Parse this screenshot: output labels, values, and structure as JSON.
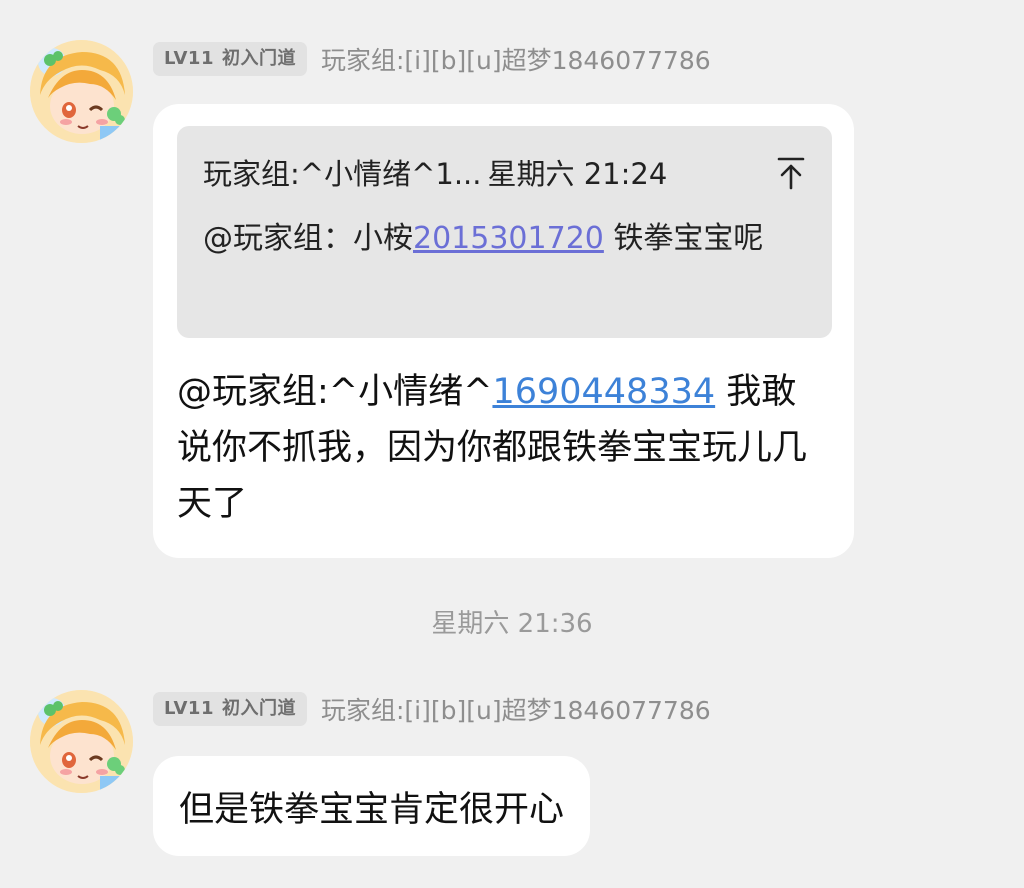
{
  "messages": [
    {
      "level": "LV11",
      "rank": "初入门道",
      "sender": "玩家组:[i][b][u]超梦1846077786",
      "quote": {
        "sender": "玩家组:^小情绪^1...",
        "time": "星期六 21:24",
        "mention_prefix": "@玩家组：小桉",
        "mention_number": "2015301720",
        "text": " 铁拳宝宝呢"
      },
      "mention_prefix": "@玩家组:^小情绪^",
      "mention_number": "1690448334",
      "text": " 我敢说你不抓我，因为你都跟铁拳宝宝玩儿几天了"
    },
    {
      "level": "LV11",
      "rank": "初入门道",
      "sender": "玩家组:[i][b][u]超梦1846077786",
      "text": "但是铁拳宝宝肯定很开心"
    }
  ],
  "timestamp": "星期六 21:36",
  "colors": {
    "background": "#f0f0f0",
    "bubble": "#ffffff",
    "quote": "#e6e6e6",
    "link_main": "#3d82d8",
    "link_quote": "#6b6fd6"
  },
  "icons": {
    "avatar": "anime-avatar",
    "jump": "arrow-up-to-top-icon"
  }
}
